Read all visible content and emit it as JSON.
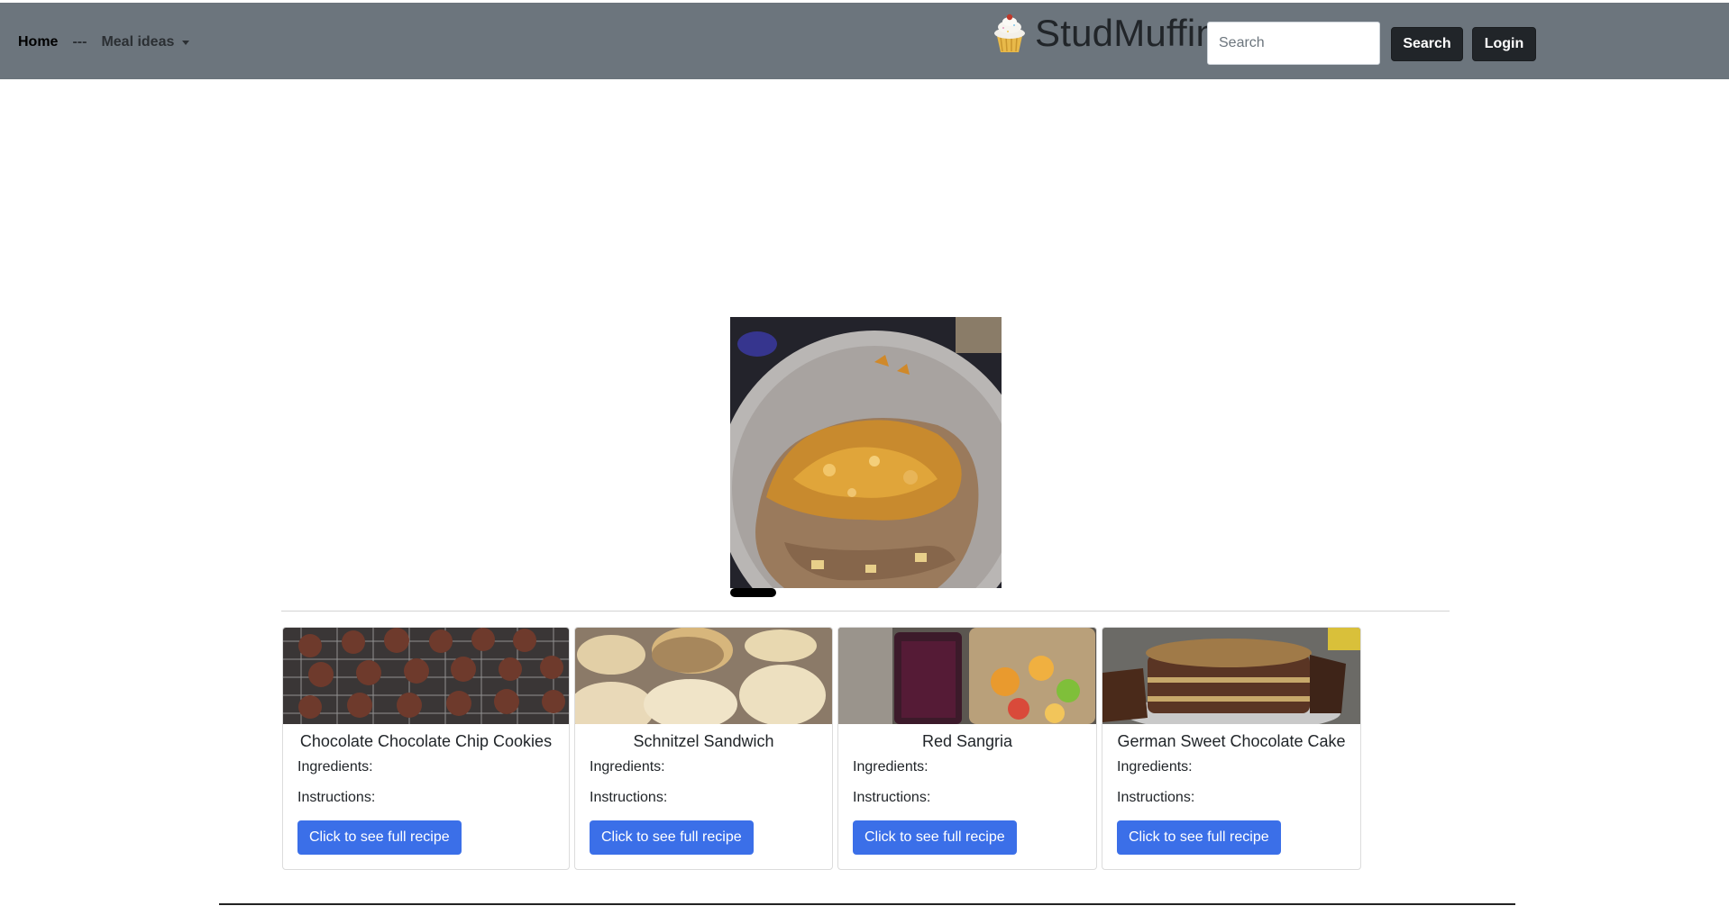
{
  "navbar": {
    "home_label": "Home",
    "separator": "---",
    "meal_ideas_label": "Meal ideas",
    "brand_icon": "cupcake-icon",
    "brand_name": "StudMuffin",
    "search_placeholder": "Search",
    "search_value": "",
    "search_button_label": "Search",
    "login_button_label": "Login"
  },
  "carousel": {
    "active_slide": 1
  },
  "recipes": [
    {
      "title": "Chocolate Chocolate Chip Cookies",
      "ingredients_label": "Ingredients:",
      "instructions_label": "Instructions:",
      "button_label": "Click to see full recipe"
    },
    {
      "title": "Schnitzel Sandwich",
      "ingredients_label": "Ingredients:",
      "instructions_label": "Instructions:",
      "button_label": "Click to see full recipe"
    },
    {
      "title": "Red Sangria",
      "ingredients_label": "Ingredients:",
      "instructions_label": "Instructions:",
      "button_label": "Click to see full recipe"
    },
    {
      "title": "German Sweet Chocolate Cake",
      "ingredients_label": "Ingredients:",
      "instructions_label": "Instructions:",
      "button_label": "Click to see full recipe"
    }
  ],
  "colors": {
    "navbar_bg": "#6c757d",
    "dark_button": "#212529",
    "primary_button": "#3b6fe8"
  }
}
